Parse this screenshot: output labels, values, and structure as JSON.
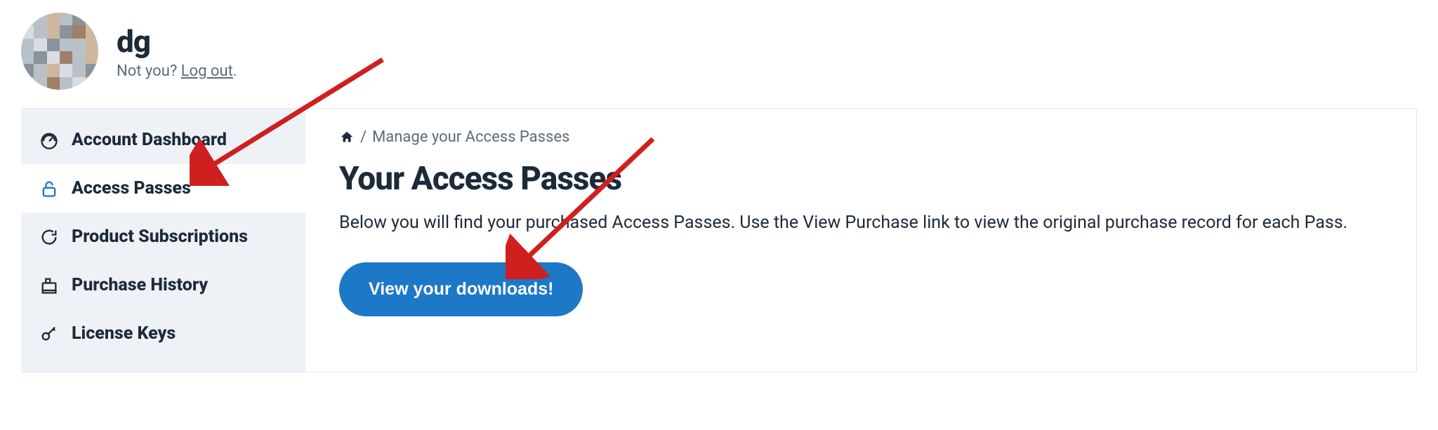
{
  "user": {
    "name": "dg",
    "not_you_prefix": "Not you? ",
    "logout_label": "Log out"
  },
  "sidebar": {
    "items": [
      {
        "label": "Account Dashboard"
      },
      {
        "label": "Access Passes"
      },
      {
        "label": "Product Subscriptions"
      },
      {
        "label": "Purchase History"
      },
      {
        "label": "License Keys"
      }
    ]
  },
  "breadcrumb": {
    "sep": "/",
    "current": "Manage your Access Passes"
  },
  "main": {
    "title": "Your Access Passes",
    "description": "Below you will find your purchased Access Passes. Use the View Purchase link to view the original purchase record for each Pass.",
    "cta_label": "View your downloads!"
  }
}
